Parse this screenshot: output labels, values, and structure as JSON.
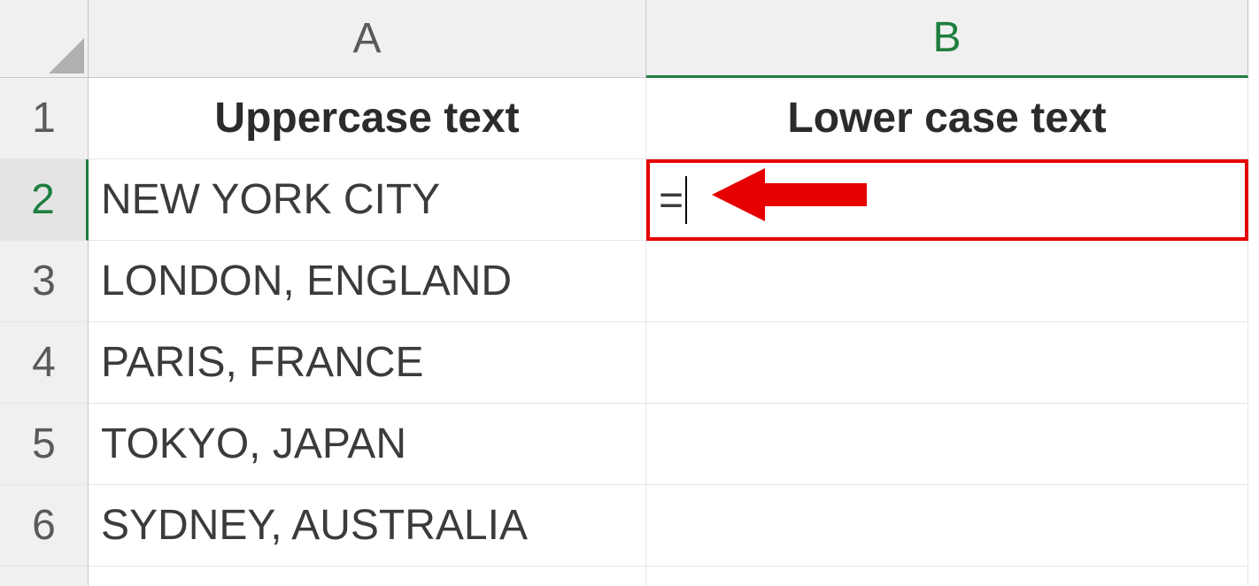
{
  "columns": [
    "A",
    "B"
  ],
  "rows": [
    "1",
    "2",
    "3",
    "4",
    "5",
    "6"
  ],
  "headers": {
    "colA": "Uppercase text",
    "colB": "Lower case text"
  },
  "dataA": {
    "r2": "NEW YORK CITY",
    "r3": "LONDON, ENGLAND",
    "r4": "PARIS, FRANCE",
    "r5": "TOKYO, JAPAN",
    "r6": "SYDNEY, AUSTRALIA"
  },
  "editing": {
    "cellRef": "B2",
    "formula": "="
  },
  "annotation": {
    "arrowColor": "#e60000"
  }
}
